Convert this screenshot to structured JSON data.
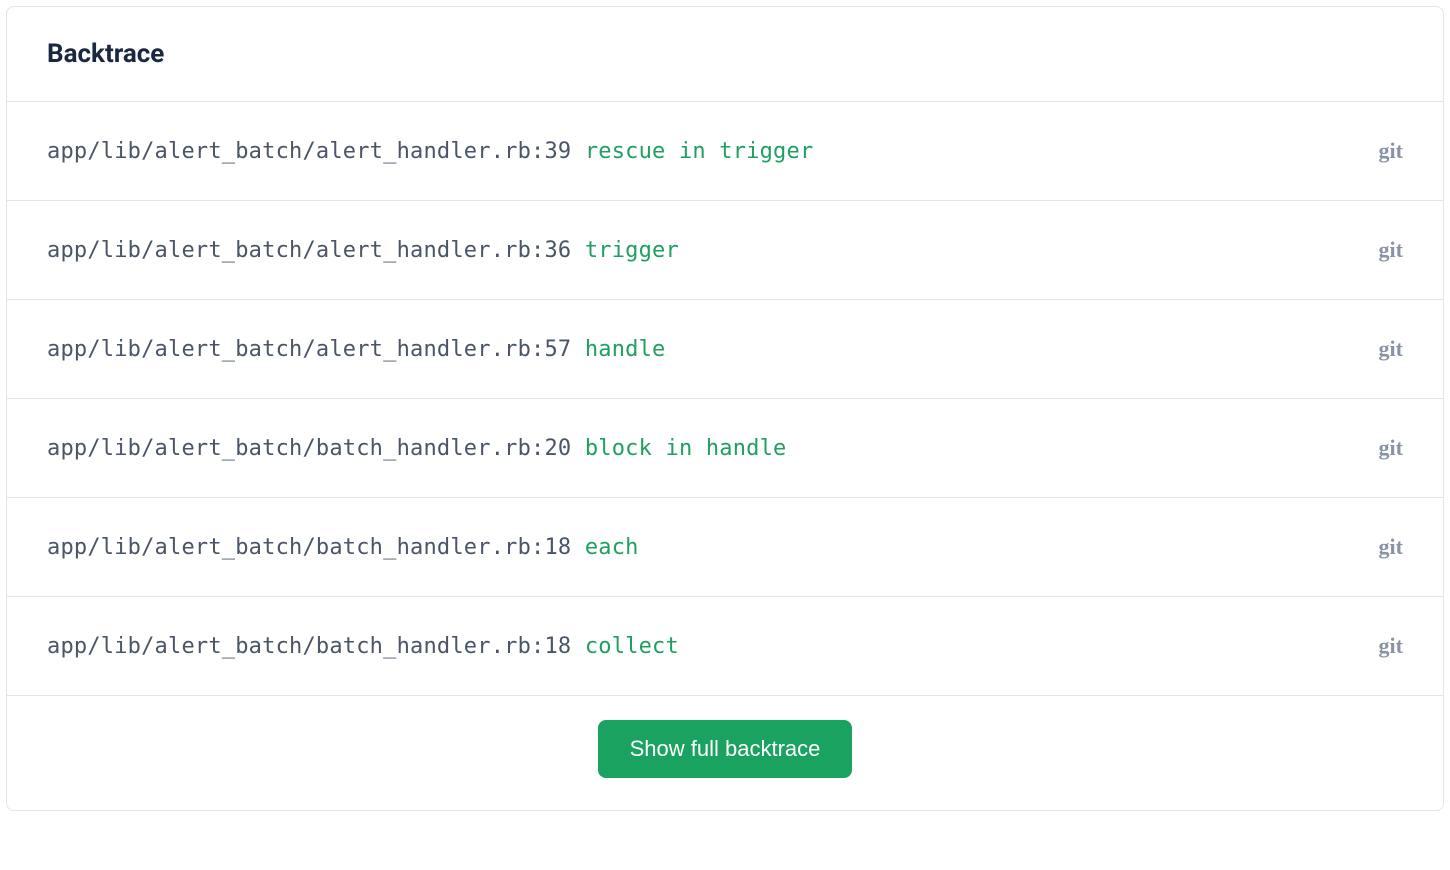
{
  "panel": {
    "title": "Backtrace",
    "show_full_label": "Show full backtrace",
    "git_label": "git"
  },
  "frames": [
    {
      "path": "app/lib/alert_batch/alert_handler.rb:39",
      "method": "rescue in trigger"
    },
    {
      "path": "app/lib/alert_batch/alert_handler.rb:36",
      "method": "trigger"
    },
    {
      "path": "app/lib/alert_batch/alert_handler.rb:57",
      "method": "handle"
    },
    {
      "path": "app/lib/alert_batch/batch_handler.rb:20",
      "method": "block in handle"
    },
    {
      "path": "app/lib/alert_batch/batch_handler.rb:18",
      "method": "each"
    },
    {
      "path": "app/lib/alert_batch/batch_handler.rb:18",
      "method": "collect"
    }
  ]
}
